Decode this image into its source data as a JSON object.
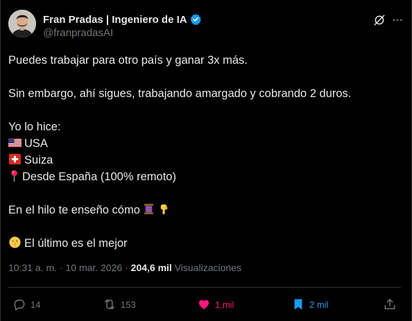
{
  "author": {
    "name": "Fran Pradas | Ingeniero de IA",
    "handle": "@franpradasAI",
    "verified": true
  },
  "icons": {
    "avatar": "avatar",
    "verified": "verified-badge-icon",
    "grok": "grok-icon",
    "more": "more-icon",
    "reply": "reply-icon",
    "repost": "repost-icon",
    "like": "heart-icon",
    "bookmark": "bookmark-icon",
    "share": "share-icon"
  },
  "post": {
    "line1": "Puedes trabajar para otro país y ganar 3x más.",
    "line2": "Sin embargo, ahí sigues, trabajando amargado y cobrando 2 duros.",
    "line3": "Yo lo hice:",
    "line4": "USA",
    "line5": "Suiza",
    "line6": "Desde España (100% remoto)",
    "line7": "En el hilo te enseño cómo",
    "line8": "El último es el mejor"
  },
  "emojis": {
    "us_flag": "us-flag-emoji",
    "swiss_flag": "swiss-flag-emoji",
    "pin": "round-pushpin-emoji",
    "thread": "thread-spool-emoji",
    "point_down": "backhand-index-pointing-down-emoji",
    "shush": "shushing-face-emoji"
  },
  "meta": {
    "timestamp": "10:31 a. m. · 10 mar. 2026 · ",
    "views": "204,6 mil",
    "views_label": " Visualizaciones"
  },
  "actions": {
    "replies": "14",
    "reposts": "153",
    "likes": "1 mil",
    "bookmarks": "2 mil"
  },
  "colors": {
    "background": "#000000",
    "text": "#e7e9ea",
    "secondary": "#71767b",
    "like": "#f91880",
    "bookmark": "#1d9bf0",
    "verified": "#1d9bf0"
  }
}
